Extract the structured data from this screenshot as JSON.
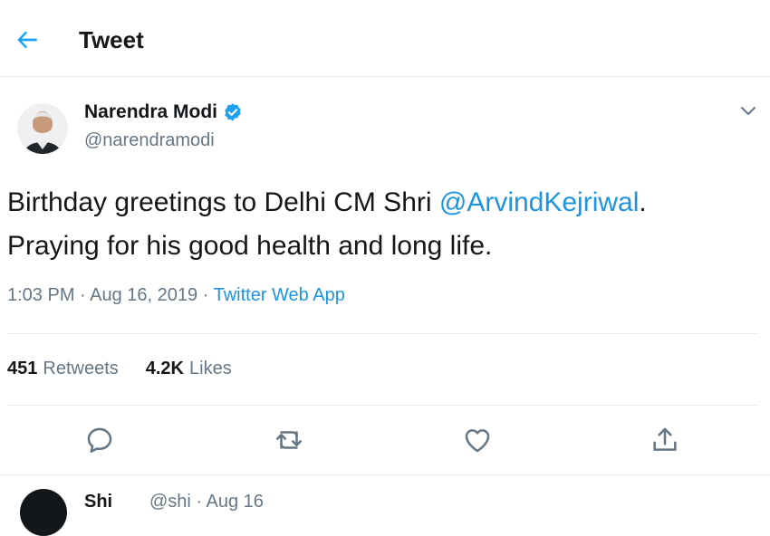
{
  "header": {
    "title": "Tweet",
    "back_icon": "arrow-left-icon"
  },
  "tweet": {
    "author_name": "Narendra Modi",
    "handle": "@narendramodi",
    "text_before": "Birthday greetings to Delhi CM Shri ",
    "mention": "@ArvindKejriwal",
    "text_after": ".",
    "text_line2": "Praying for his good health and long life.",
    "time": "1:03 PM",
    "date": "Aug 16, 2019",
    "separator": " · ",
    "source": "Twitter Web App"
  },
  "stats": {
    "retweets_count": "451",
    "retweets_label": "Retweets",
    "likes_count": "4.2K",
    "likes_label": "Likes"
  },
  "actions": [
    "reply-icon",
    "retweet-icon",
    "like-icon",
    "share-icon"
  ],
  "reply_preview": {
    "name": "Shi",
    "meta": "@shi · Aug 16"
  },
  "colors": {
    "accent": "#1da1f2",
    "link": "#1b95e0",
    "secondary_text": "#657786",
    "divider": "#e6ecf0"
  }
}
